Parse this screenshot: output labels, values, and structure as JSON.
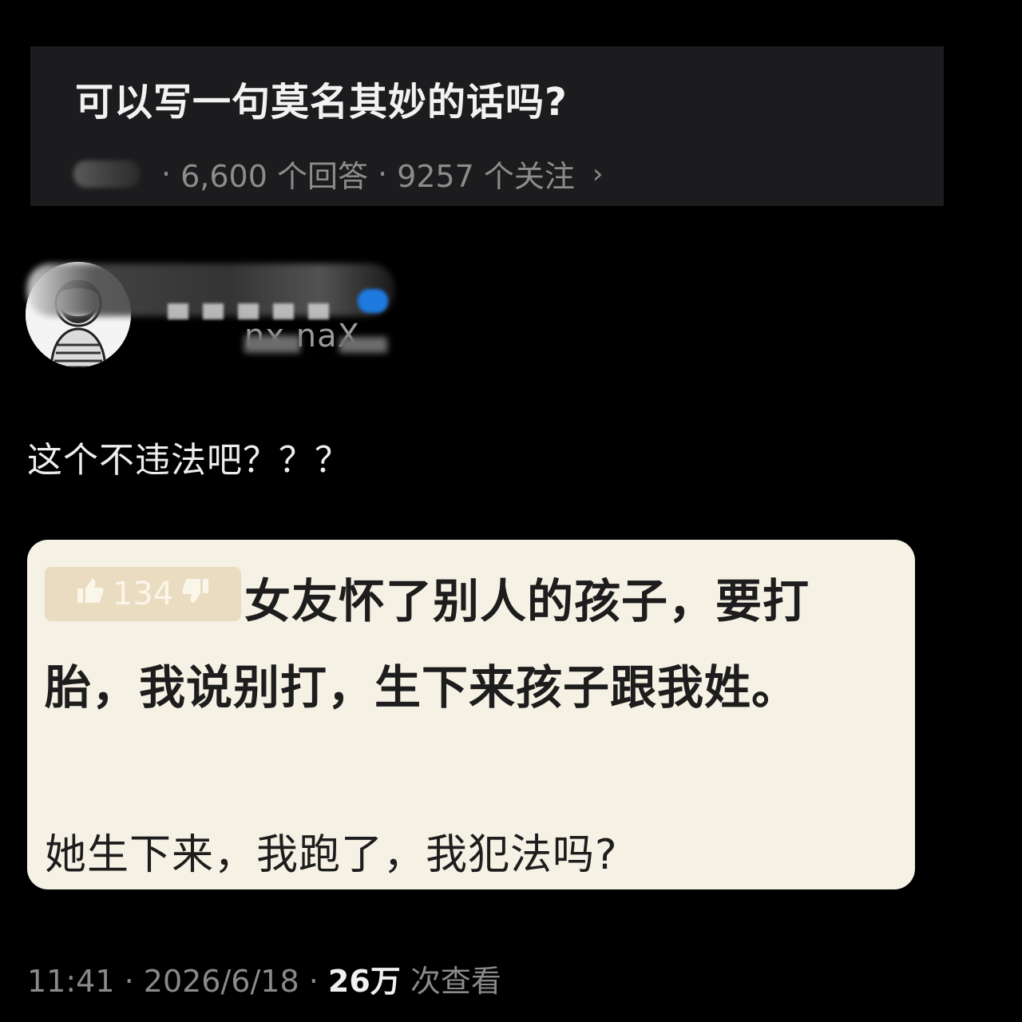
{
  "question": {
    "title": "可以写一句莫名其妙的话吗?",
    "source": "知乎",
    "separator": "·",
    "answers": "6,600 个回答",
    "follows": "9257 个关注",
    "chevron": "›"
  },
  "author": {
    "avatar": "avatar",
    "handle": "nx  naX"
  },
  "answer": {
    "text": "这个不违法吧？？？"
  },
  "quote": {
    "vote_count": "134",
    "line1": "女友怀了别人的孩子，要打",
    "line2": "胎，我说别打，生下来孩子跟我姓。",
    "line3": "她生下来，我跑了，我犯法吗?"
  },
  "footer": {
    "time": "11:41",
    "date": "2026/6/18",
    "views": "26万",
    "views_label": "次查看"
  }
}
